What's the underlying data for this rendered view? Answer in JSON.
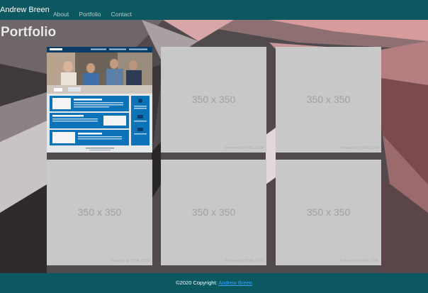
{
  "navbar": {
    "brand": "Andrew Breen",
    "links": [
      "About",
      "Portfolio",
      "Contact"
    ]
  },
  "page": {
    "title": "Portfolio"
  },
  "portfolio": {
    "items": [
      {
        "kind": "website-screenshot",
        "header_brand": "Northwind",
        "sections": [
          "Search Engine Optimization",
          "Online Reputation Management",
          "Social Media Marketing"
        ]
      },
      {
        "kind": "placeholder",
        "text": "350 x 350",
        "credit": "Powered by HTML.COM"
      },
      {
        "kind": "placeholder",
        "text": "350 x 350",
        "credit": "Powered by HTML.COM"
      },
      {
        "kind": "placeholder",
        "text": "350 x 350",
        "credit": "Powered by HTML.COM"
      },
      {
        "kind": "placeholder",
        "text": "350 x 350",
        "credit": "Powered by HTML.COM"
      },
      {
        "kind": "placeholder",
        "text": "350 x 350",
        "credit": "Powered by HTML.COM"
      }
    ]
  },
  "footer": {
    "copyright": "©2020 Copyright: ",
    "link_text": "Andrew Breen"
  },
  "colors": {
    "navbar_bg": "#0b5860",
    "footer_link": "#3aa3ff",
    "placeholder_bg": "#c8c8c8"
  }
}
